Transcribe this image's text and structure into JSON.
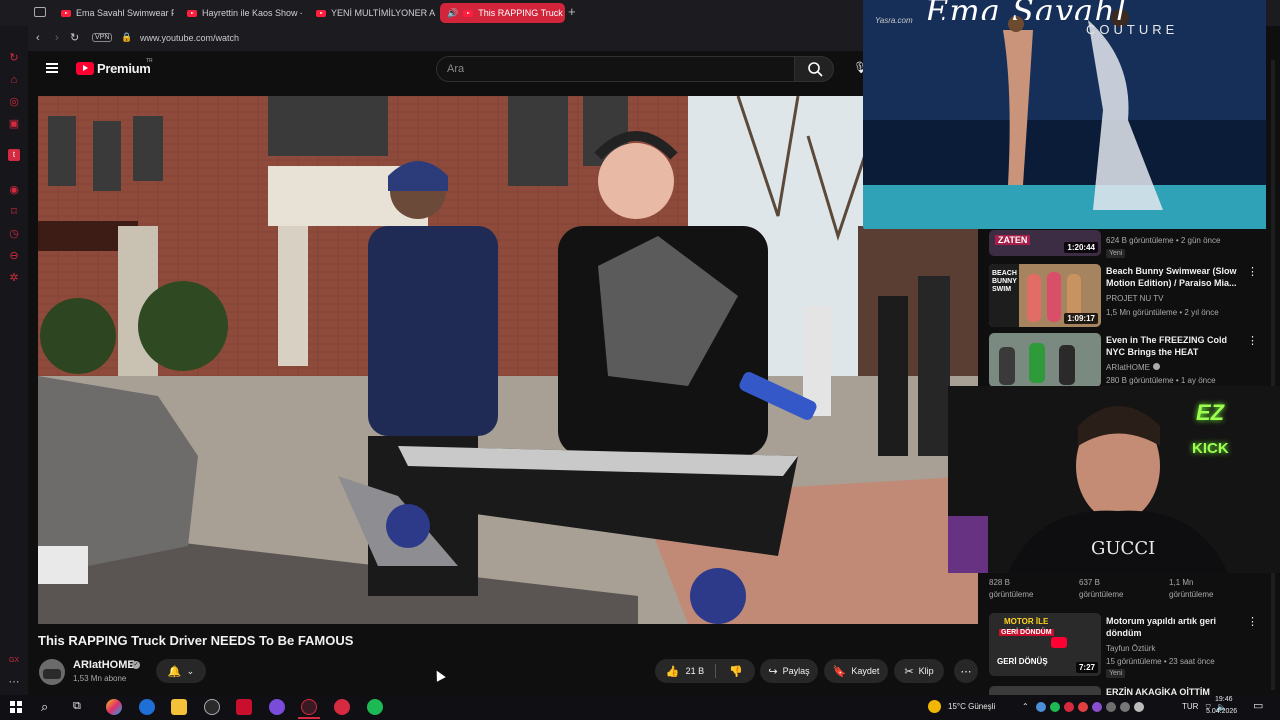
{
  "browser": {
    "tabs": [
      {
        "label": "Ema Savahl Swimwear Fa",
        "active": false
      },
      {
        "label": "Hayrettin ile Kaos Show -",
        "active": false
      },
      {
        "label": "YENİ MULTİMİLYONER AR",
        "active": false
      },
      {
        "label": "This RAPPING Truck D",
        "active": true
      }
    ],
    "vpn": "VPN",
    "url": "www.youtube.com/watch"
  },
  "youtube": {
    "logo": "Premium",
    "logo_sup": "TR",
    "search_placeholder": "Ara"
  },
  "video": {
    "title": "This RAPPING Truck Driver NEEDS To Be FAMOUS",
    "channel": "ARIatHOME",
    "subscribers": "1,53 Mn abone",
    "likes": "21 B",
    "share": "Paylaş",
    "save": "Kaydet",
    "clip": "Klip"
  },
  "overlay_top": {
    "watermark": "Yasra.com",
    "banner_text": "COUTURE"
  },
  "overlay_cam": {
    "badge_top": "EZ",
    "badge_bottom": "KICK",
    "shirt_text": "GUCCI"
  },
  "recommendations": [
    {
      "thumb_text": "ZATEN",
      "duration": "1:20:44",
      "meta": "624 B görüntüleme • 2 gün önce",
      "badge": "Yeni"
    },
    {
      "thumb_text": "BEACH BUNNY SWIM",
      "title": "Beach Bunny Swimwear (Slow Motion Edition) / Paraiso Mia...",
      "channel": "PROJET NU TV",
      "meta": "1,5 Mn görüntüleme • 2 yıl önce",
      "duration": "1:09:17"
    },
    {
      "title": "Even in The FREEZING Cold NYC Brings the HEAT",
      "channel": "ARIatHOME",
      "meta": "280 B görüntüleme • 1 ay önce"
    },
    {
      "partial": [
        "828 B",
        "görüntüleme",
        "637 B",
        "görüntüleme",
        "1,1 Mn",
        "görüntüleme"
      ]
    },
    {
      "thumb_text_top": "MOTOR İLE",
      "thumb_text_mid": "GERİ DÖNDÜM",
      "thumb_text_bot": "GERİ DÖNÜŞ",
      "duration": "7:27",
      "title": "Motorum yapıldı artık geri döndüm",
      "channel": "Tayfun Öztürk",
      "meta": "15 görüntüleme • 23 saat önce",
      "badge": "Yeni"
    },
    {
      "title": "ERZİN AKAGİKA OİTTİM"
    }
  ],
  "taskbar": {
    "weather": "15°C  Güneşli",
    "lang": "TUR",
    "time": "19:46",
    "date": "5.04.2026"
  }
}
